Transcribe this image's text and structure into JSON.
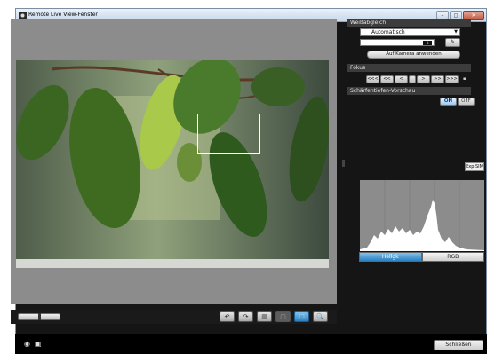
{
  "window": {
    "title": "Remote Live View-Fenster",
    "controls": [
      "–",
      "◻",
      "✕"
    ]
  },
  "white_balance": {
    "header": "Weißabgleich",
    "mode": "Automatisch",
    "kelvin_unit": "K",
    "apply_button": "Auf Kamera anwenden"
  },
  "focus": {
    "header": "Fokus",
    "buttons": [
      "<<<",
      "<<",
      "<",
      "",
      ">",
      ">>",
      ">>>"
    ]
  },
  "dof_preview": {
    "header": "Schärfentiefen-Vorschau",
    "on_label": "ON",
    "off_label": "OFF",
    "active": "ON"
  },
  "exposure_sim": {
    "label": "Exp.SIM"
  },
  "histogram": {
    "tabs": [
      "Hellgk",
      "RGB"
    ],
    "active_tab": "Hellgk"
  },
  "viewer_toolbar": {
    "buttons": [
      "↶",
      "↷",
      "▥",
      "▢",
      "⬚",
      "🔍"
    ],
    "active_button": "⬚"
  },
  "footer": {
    "close_button": "Schließen"
  },
  "colors": {
    "accent": "#2d7fc0",
    "background": "#151515"
  }
}
